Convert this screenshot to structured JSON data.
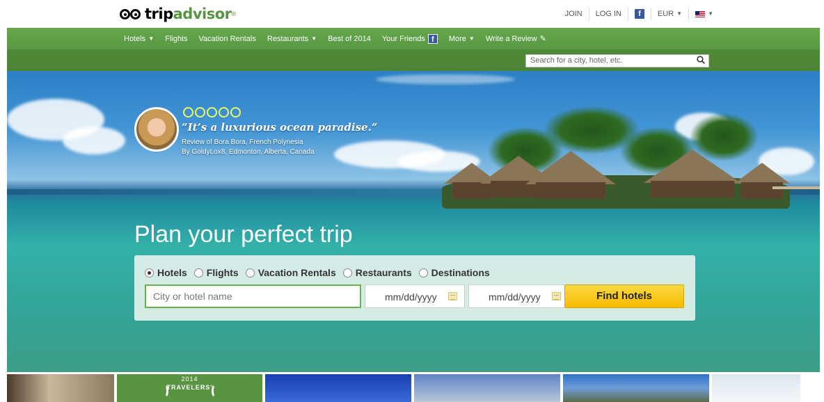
{
  "header": {
    "logo_dark": "trip",
    "logo_green": "advisor",
    "logo_tm": "®",
    "links": {
      "join": "JOIN",
      "login": "LOG IN",
      "facebook": "f",
      "currency": "EUR"
    }
  },
  "nav": {
    "items": [
      {
        "label": "Hotels",
        "dropdown": true
      },
      {
        "label": "Flights",
        "dropdown": false
      },
      {
        "label": "Vacation Rentals",
        "dropdown": false
      },
      {
        "label": "Restaurants",
        "dropdown": true
      },
      {
        "label": "Best of 2014",
        "dropdown": false
      },
      {
        "label": "Your Friends",
        "dropdown": false
      },
      {
        "label": "More",
        "dropdown": true
      },
      {
        "label": "Write a Review",
        "dropdown": false
      }
    ],
    "facebook_glyph": "f"
  },
  "site_search": {
    "placeholder": "Search for a city, hotel, etc."
  },
  "hero": {
    "quote": "“It’s a luxurious ocean paradise.”",
    "review_of": "Review of Bora Bora, French Polynesia",
    "review_by": "By GoldyLox8, Edmonton, Alberta, Canada",
    "rating_bubbles": 5
  },
  "planner": {
    "title": "Plan your perfect trip",
    "tabs": [
      {
        "label": "Hotels",
        "selected": true
      },
      {
        "label": "Flights",
        "selected": false
      },
      {
        "label": "Vacation Rentals",
        "selected": false
      },
      {
        "label": "Restaurants",
        "selected": false
      },
      {
        "label": "Destinations",
        "selected": false
      }
    ],
    "city_placeholder": "City or hotel name",
    "checkin_placeholder": "mm/dd/yyyy",
    "checkout_placeholder": "mm/dd/yyyy",
    "submit": "Find hotels"
  },
  "promo": {
    "year": "2014",
    "label": "TRAVELERS'"
  },
  "colors": {
    "brand_green": "#589442",
    "nav_green": "#5fa347",
    "button_yellow": "#ffcc00",
    "facebook_blue": "#3b5998"
  }
}
